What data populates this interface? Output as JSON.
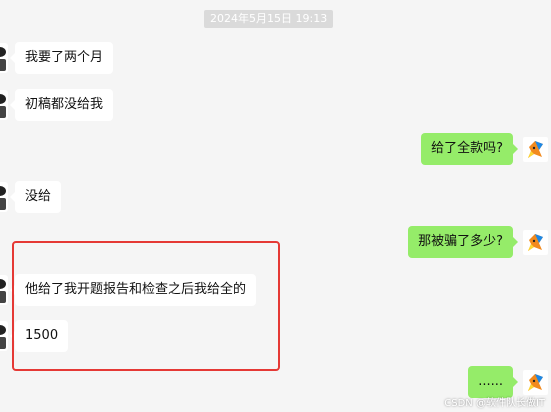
{
  "timestamp": "2024年5月15日 19:13",
  "messages": [
    {
      "side": "left",
      "text": "我要了两个月"
    },
    {
      "side": "left",
      "text": "初稿都没给我"
    },
    {
      "side": "right",
      "text": "给了全款吗?"
    },
    {
      "side": "left",
      "text": "没给"
    },
    {
      "side": "right",
      "text": "那被骗了多少?"
    },
    {
      "side": "left",
      "text": "他给了我开题报告和检查之后我给全的"
    },
    {
      "side": "left",
      "text": "1500"
    },
    {
      "side": "right",
      "text": "......"
    }
  ],
  "icons": {
    "left_avatar": "contact-avatar-icon",
    "right_avatar": "fox-avatar-icon"
  },
  "colors": {
    "background": "#f5f5f5",
    "left_bubble": "#ffffff",
    "right_bubble": "#95ec69",
    "highlight": "#e53935"
  },
  "watermark": "CSDN @软件队长做IT"
}
